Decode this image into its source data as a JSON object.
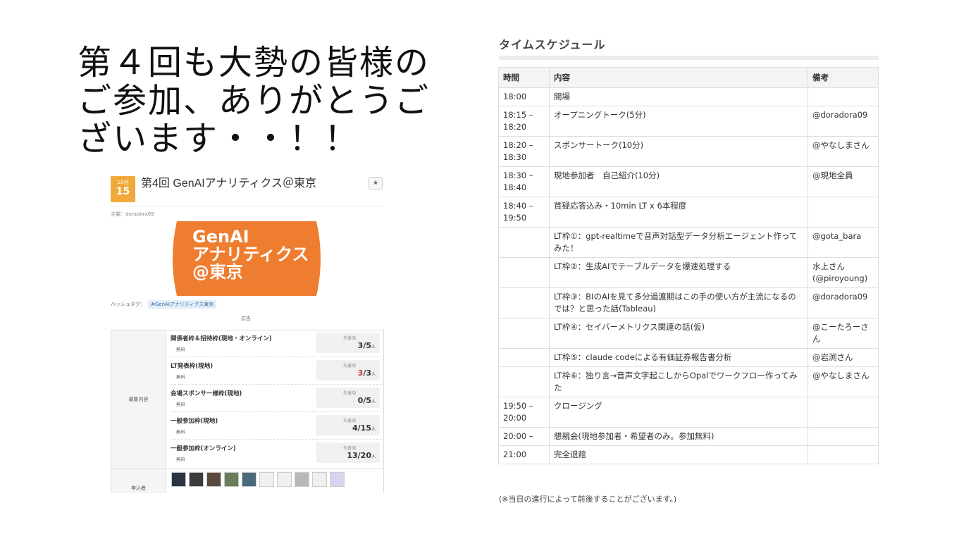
{
  "headline": "第４回も大勢の皆様の\nご参加、ありがとうご\nざいます・・！！",
  "event": {
    "month": "10月",
    "day": "15",
    "title": "第4回 GenAIアナリティクス＠東京",
    "star": "★",
    "organizer": "主催：doradora09",
    "banner_lines": [
      "GenAI",
      "アナリティクス",
      "@東京"
    ],
    "banner_color": "#ee7d30",
    "hashtag_label": "ハッシュタグ：",
    "hashtag": "#GenAIアナリティクス東京",
    "ad_label": "広告",
    "recruit_label": "募集内容",
    "frames": [
      {
        "name": "関係者枠＆招待枠(現地・オンライン)",
        "fee": "無料",
        "order": "先着順",
        "count": "3",
        "cap": "/5",
        "unit": "人",
        "full": false
      },
      {
        "name": "LT発表枠(現地)",
        "fee": "無料",
        "order": "先着順",
        "count": "3",
        "cap": "/3",
        "unit": "人",
        "full": true
      },
      {
        "name": "会場スポンサー様枠(現地)",
        "fee": "無料",
        "order": "先着順",
        "count": "0",
        "cap": "/5",
        "unit": "人",
        "full": false
      },
      {
        "name": "一般参加枠(現地)",
        "fee": "無料",
        "order": "先着順",
        "count": "4",
        "cap": "/15",
        "unit": "人",
        "full": false
      },
      {
        "name": "一般参加枠(オンライン)",
        "fee": "無料",
        "order": "先着順",
        "count": "13",
        "cap": "/20",
        "unit": "人",
        "full": false
      }
    ],
    "applicants_label": "申込者",
    "avatar_count": 10
  },
  "timetable": {
    "title": "タイムスケジュール",
    "headers": [
      "時間",
      "内容",
      "備考"
    ],
    "rows": [
      [
        "18:00",
        "開場",
        ""
      ],
      [
        "18:15 –\n18:20",
        "オープニングトーク(5分)",
        "@doradora09"
      ],
      [
        "18:20 –\n18:30",
        "スポンサートーク(10分)",
        "@やなしまさん"
      ],
      [
        "18:30 –\n18:40",
        "現地参加者　自己紹介(10分)",
        "@現地全員"
      ],
      [
        "18:40 –\n19:50",
        "質疑応答込み・10min LT x 6本程度",
        ""
      ],
      [
        "",
        "LT枠①：gpt-realtimeで音声対話型データ分析エージェント作ってみた！",
        "@gota_bara"
      ],
      [
        "",
        "LT枠②：生成AIでテーブルデータを爆速処理する",
        "水上さん\n(@piroyoung)"
      ],
      [
        "",
        "LT枠③：BIのAIを見て多分過渡期はこの手の使い方が主流になるのでは？と思った話(Tableau)",
        "@doradora09"
      ],
      [
        "",
        "LT枠④：セイバーメトリクス関連の話(仮)",
        "@こーたろーさん"
      ],
      [
        "",
        "LT枠⑤：claude codeによる有価証券報告書分析",
        "@岩渕さん"
      ],
      [
        "",
        "LT枠⑥：独り言→音声文字起こしからOpalでワークフロー作ってみた",
        "@やなしまさん"
      ],
      [
        "19:50 –\n20:00",
        "クロージング",
        ""
      ],
      [
        "20:00 –",
        "懇親会(現地参加者・希望者のみ。参加無料)",
        ""
      ],
      [
        "21:00",
        "完全退館",
        ""
      ]
    ],
    "footnote": "(※当日の進行によって前後することがございます。)"
  }
}
